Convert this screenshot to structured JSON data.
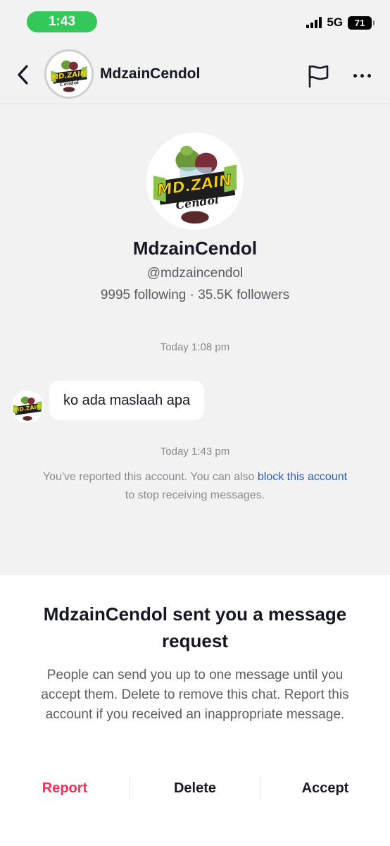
{
  "status_bar": {
    "time": "1:43",
    "network": "5G",
    "battery": "71"
  },
  "header": {
    "name": "MdzainCendol",
    "icons": [
      "chevron-left-icon",
      "flag-icon",
      "more-icon"
    ]
  },
  "logo": {
    "line1": "MD.ZAIN",
    "line2": "Cendol"
  },
  "profile": {
    "name": "MdzainCendol",
    "handle": "@mdzaincendol",
    "stats": "9995 following · 35.5K followers"
  },
  "chat": {
    "timestamp_1": "Today 1:08 pm",
    "message": "ko ada maslaah apa",
    "timestamp_2": "Today 1:43 pm",
    "notice_before": "You've reported this account. You can also ",
    "notice_link": "block this account",
    "notice_after": " to stop receiving messages."
  },
  "sheet": {
    "title": "MdzainCendol sent you a message request",
    "body": "People can send you up to one message until you accept them. Delete to remove this chat. Report this account if you received an inappropriate message.",
    "report_label": "Report",
    "delete_label": "Delete",
    "accept_label": "Accept"
  },
  "colors": {
    "accent_red": "#fe2c55",
    "link_blue": "#2b5db8",
    "status_green": "#34c759"
  }
}
